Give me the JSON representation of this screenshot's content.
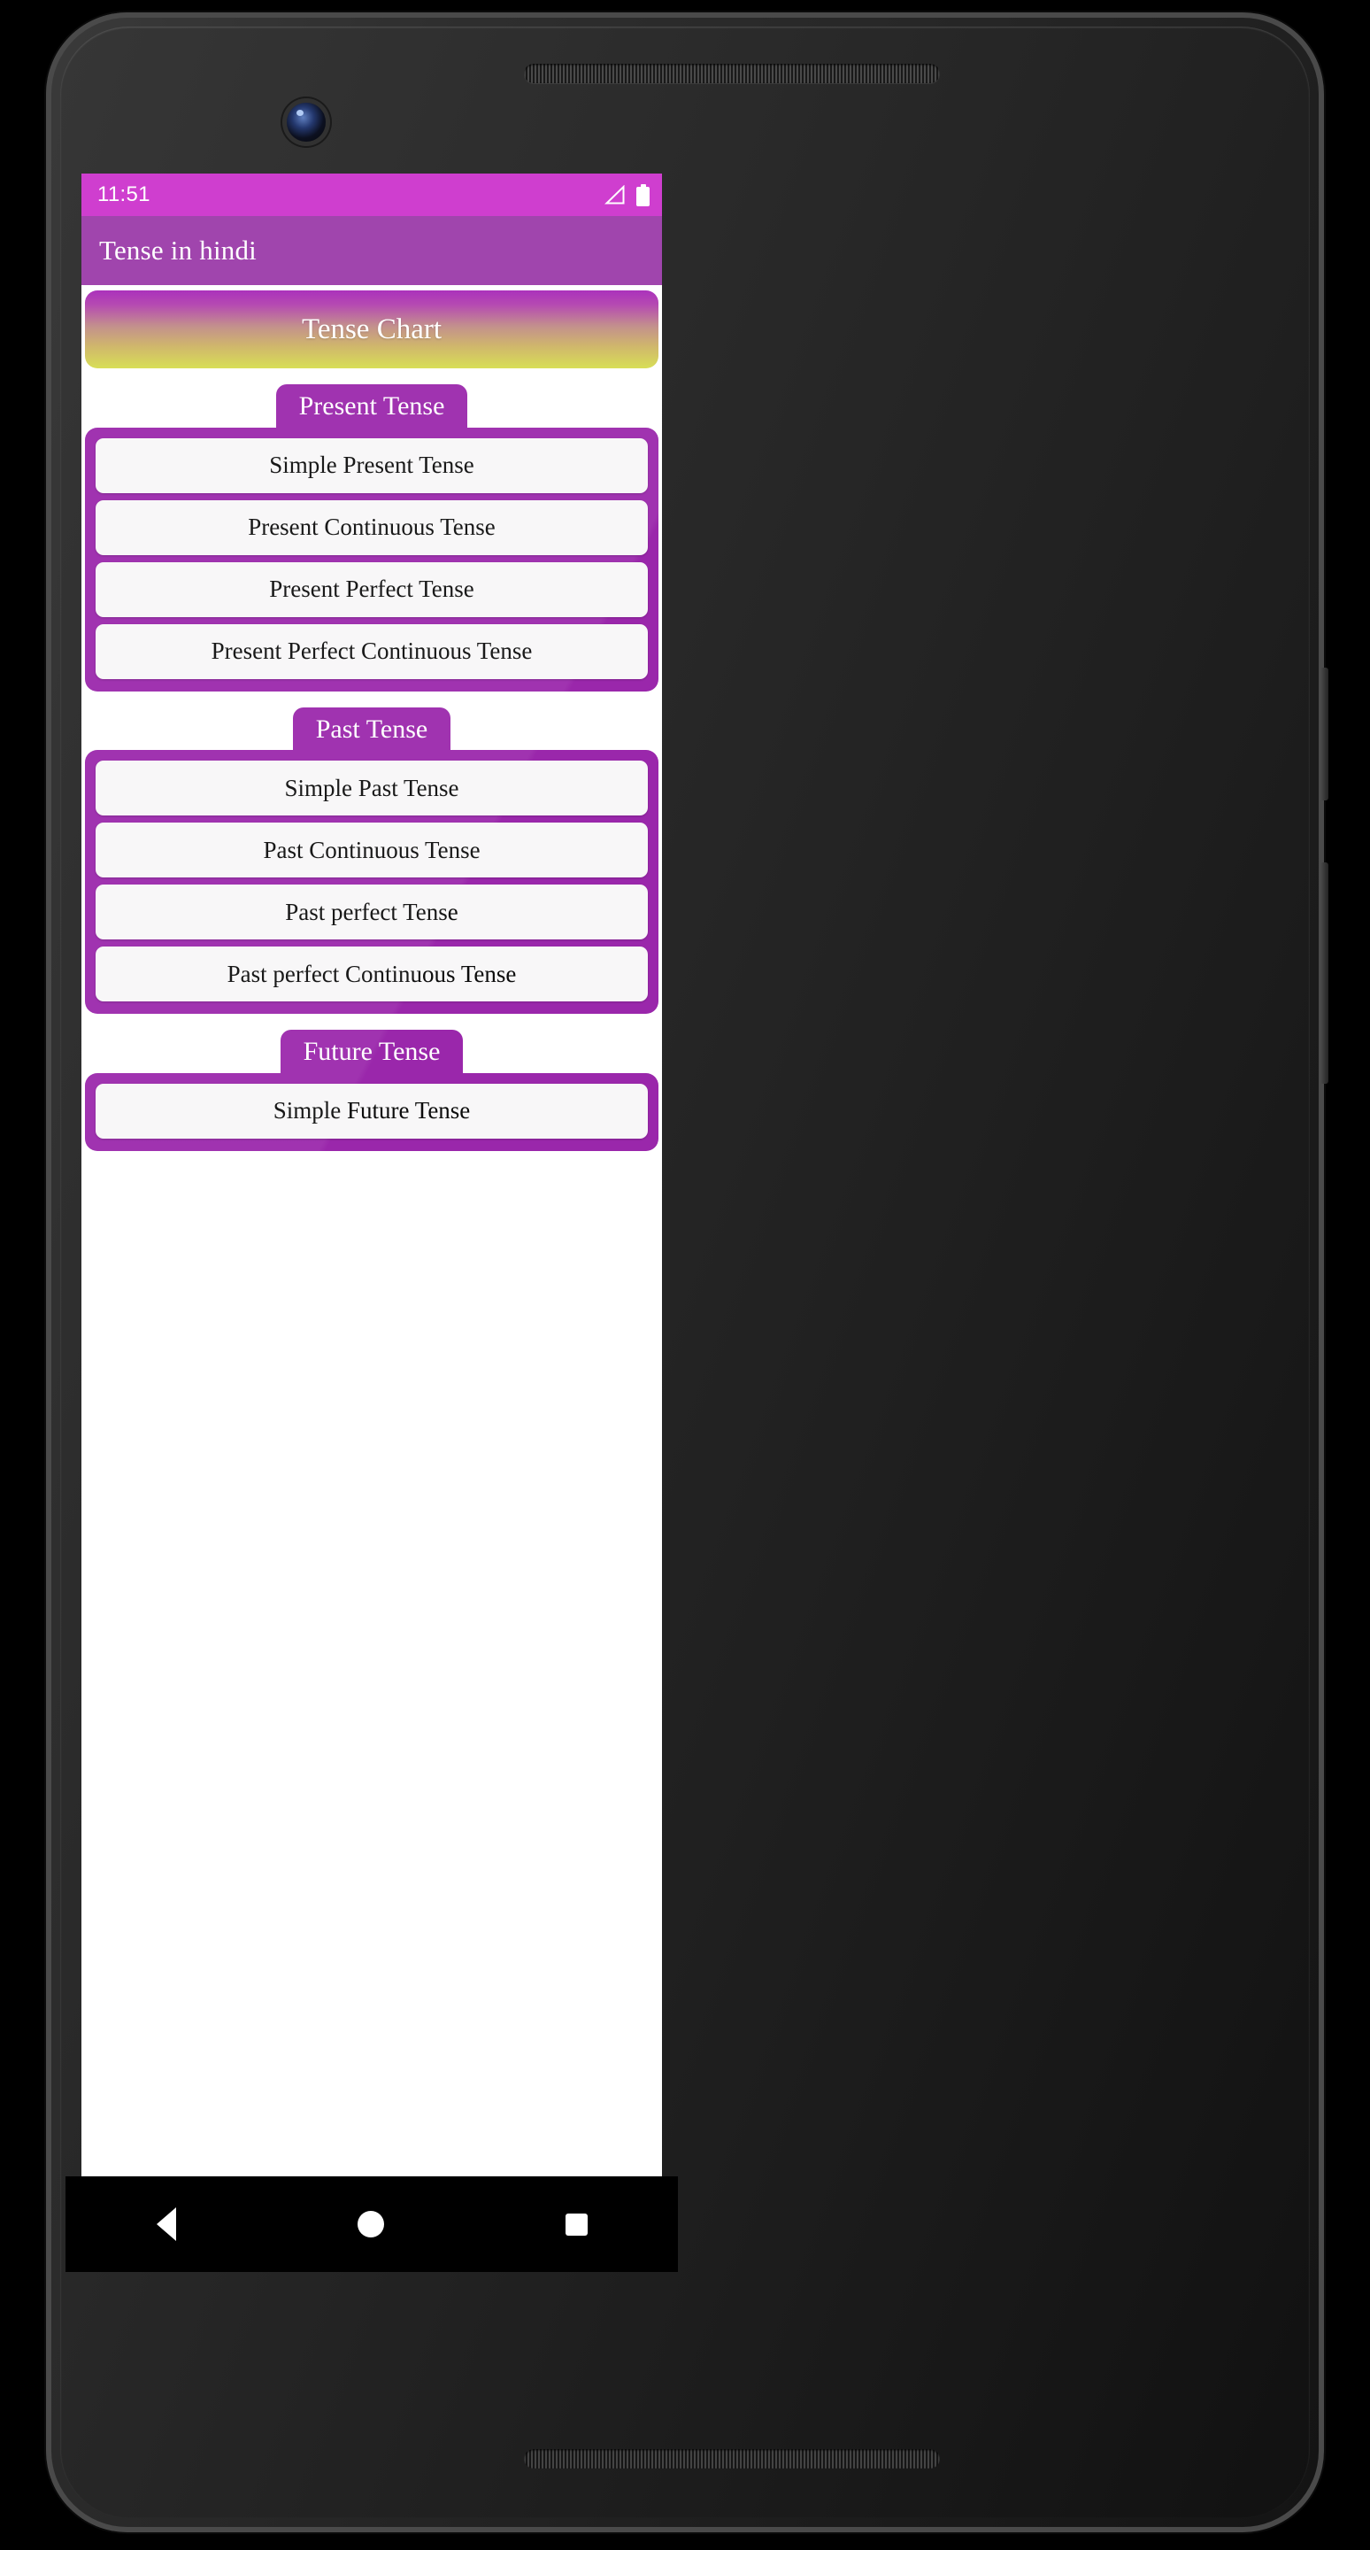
{
  "status_bar": {
    "time": "11:51",
    "icons": [
      "signal-triangle-icon",
      "battery-icon"
    ]
  },
  "app_bar": {
    "title": "Tense in hindi"
  },
  "banner": {
    "label": "Tense Chart",
    "gradient_top": "#a626b8",
    "gradient_bottom": "#d6dd4d"
  },
  "theme": {
    "accent_purple": "#9a27ab",
    "appbar_purple": "#9a3aa8",
    "statusbar_magenta": "#cc33cc",
    "item_background": "#f8f7f8"
  },
  "sections": [
    {
      "tab_label": "Present Tense",
      "items": [
        "Simple Present Tense",
        "Present Continuous Tense",
        "Present Perfect Tense",
        "Present Perfect Continuous Tense"
      ]
    },
    {
      "tab_label": "Past Tense",
      "items": [
        "Simple Past Tense",
        "Past Continuous Tense",
        "Past perfect Tense",
        "Past perfect Continuous Tense"
      ]
    },
    {
      "tab_label": "Future Tense",
      "items": [
        "Simple Future Tense"
      ]
    }
  ],
  "nav_bar": {
    "back": "back-triangle-icon",
    "home": "home-circle-icon",
    "recents": "recents-square-icon"
  }
}
